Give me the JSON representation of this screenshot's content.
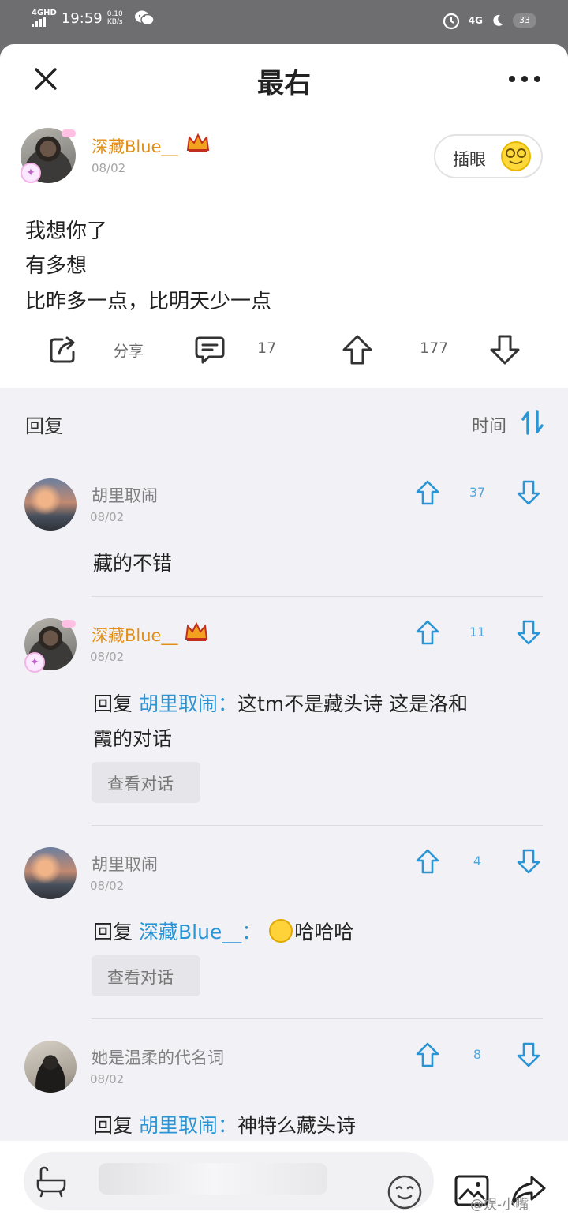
{
  "status_bar": {
    "network": "4GHD",
    "time": "19:59",
    "speed_value": "0.10",
    "speed_unit": "KB/s",
    "app_icon": "wechat-icon",
    "right_network": "4G",
    "battery": "33"
  },
  "header": {
    "title": "最右",
    "close_icon": "close-icon",
    "more_icon": "more-icon"
  },
  "post": {
    "author": "深藏Blue__",
    "date": "08/02",
    "poke_label": "插眼",
    "lines": [
      "我想你了",
      "有多想",
      "比昨多一点，比明天少一点"
    ],
    "actions": {
      "share_label": "分享",
      "comments": "17",
      "upvotes": "177"
    }
  },
  "replies_header": {
    "title": "回复",
    "sort_label": "时间"
  },
  "comments": [
    {
      "author": "胡里取闹",
      "date": "08/02",
      "votes": "37",
      "text": "藏的不错"
    },
    {
      "author": "深藏Blue__",
      "date": "08/02",
      "votes": "11",
      "reply_prefix": "回复",
      "mention": "胡里取闹",
      "separator": "：",
      "text_line1": "这tm不是藏头诗 这是洛和",
      "text_line2": "霞的对话",
      "view_conversation": "查看对话"
    },
    {
      "author": "胡里取闹",
      "date": "08/02",
      "votes": "4",
      "reply_prefix": "回复",
      "mention": "深藏Blue__",
      "separator": "：",
      "text": "哈哈哈",
      "view_conversation": "查看对话"
    },
    {
      "author": "她是温柔的代名词",
      "date": "08/02",
      "votes": "8",
      "reply_prefix": "回复",
      "mention": "胡里取闹",
      "separator": "：",
      "text": "神特么藏头诗"
    }
  ],
  "bottom_bar": {
    "watermark": "@娱-小嘴"
  },
  "colors": {
    "accent_blue": "#2a95d5",
    "vip_orange": "#e28e16"
  }
}
